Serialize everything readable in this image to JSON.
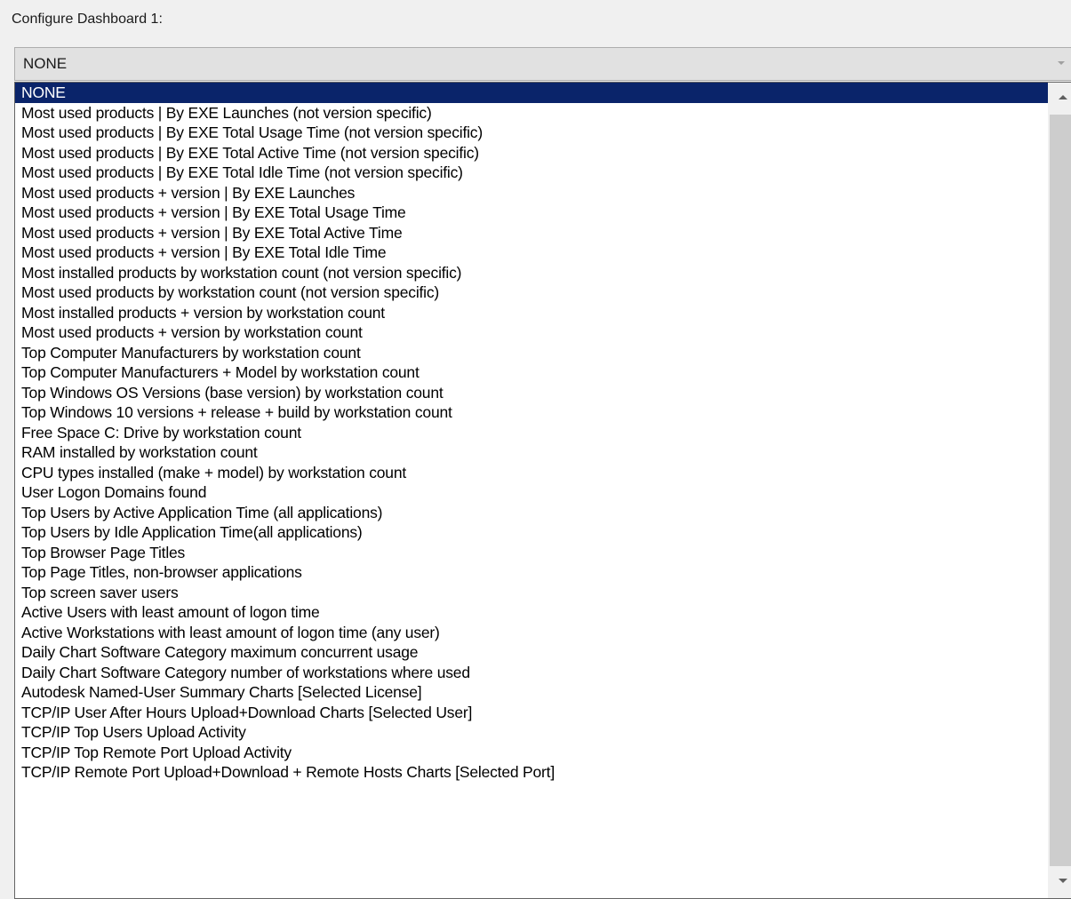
{
  "dialog": {
    "label": "Configure Dashboard 1:"
  },
  "combo": {
    "selected_value": "NONE"
  },
  "dropdown": {
    "items": [
      "NONE",
      "Most used products | By EXE Launches (not version specific)",
      "Most used products | By EXE Total Usage Time (not version specific)",
      "Most used products | By EXE Total Active Time (not version specific)",
      "Most used products | By EXE Total Idle Time (not version specific)",
      "Most used products + version | By EXE Launches",
      "Most used products + version | By EXE Total Usage Time",
      "Most used products + version | By EXE Total Active Time",
      "Most used products + version | By EXE Total Idle Time",
      "Most installed products by workstation count (not version specific)",
      "Most used products by workstation count (not version specific)",
      "Most installed products + version by workstation count",
      "Most used products + version by workstation count",
      "Top Computer Manufacturers by workstation count",
      "Top Computer Manufacturers + Model by workstation count",
      "Top Windows OS Versions (base version) by workstation count",
      "Top Windows 10 versions + release + build by workstation count",
      "Free Space C: Drive by workstation count",
      "RAM installed by workstation count",
      "CPU types installed (make + model) by workstation count",
      "User Logon Domains found",
      "Top Users by Active Application Time (all applications)",
      "Top Users by Idle Application Time(all applications)",
      "Top Browser Page Titles",
      "Top Page Titles, non-browser applications",
      "Top screen saver users",
      "Active Users with least amount of logon time",
      "Active Workstations with least amount of logon time (any user)",
      "Daily Chart Software Category maximum concurrent usage",
      "Daily Chart Software Category number of workstations where used",
      "Autodesk Named-User Summary Charts [Selected License]",
      "TCP/IP User After Hours Upload+Download Charts [Selected User]",
      "TCP/IP Top Users Upload Activity",
      "TCP/IP Top Remote Port Upload Activity",
      "TCP/IP Remote Port Upload+Download + Remote Hosts Charts [Selected Port]"
    ],
    "selected_index": 0
  },
  "colors": {
    "selection_background": "#0a246a",
    "selection_text": "#ffffff",
    "window_background": "#f0f0f0"
  }
}
